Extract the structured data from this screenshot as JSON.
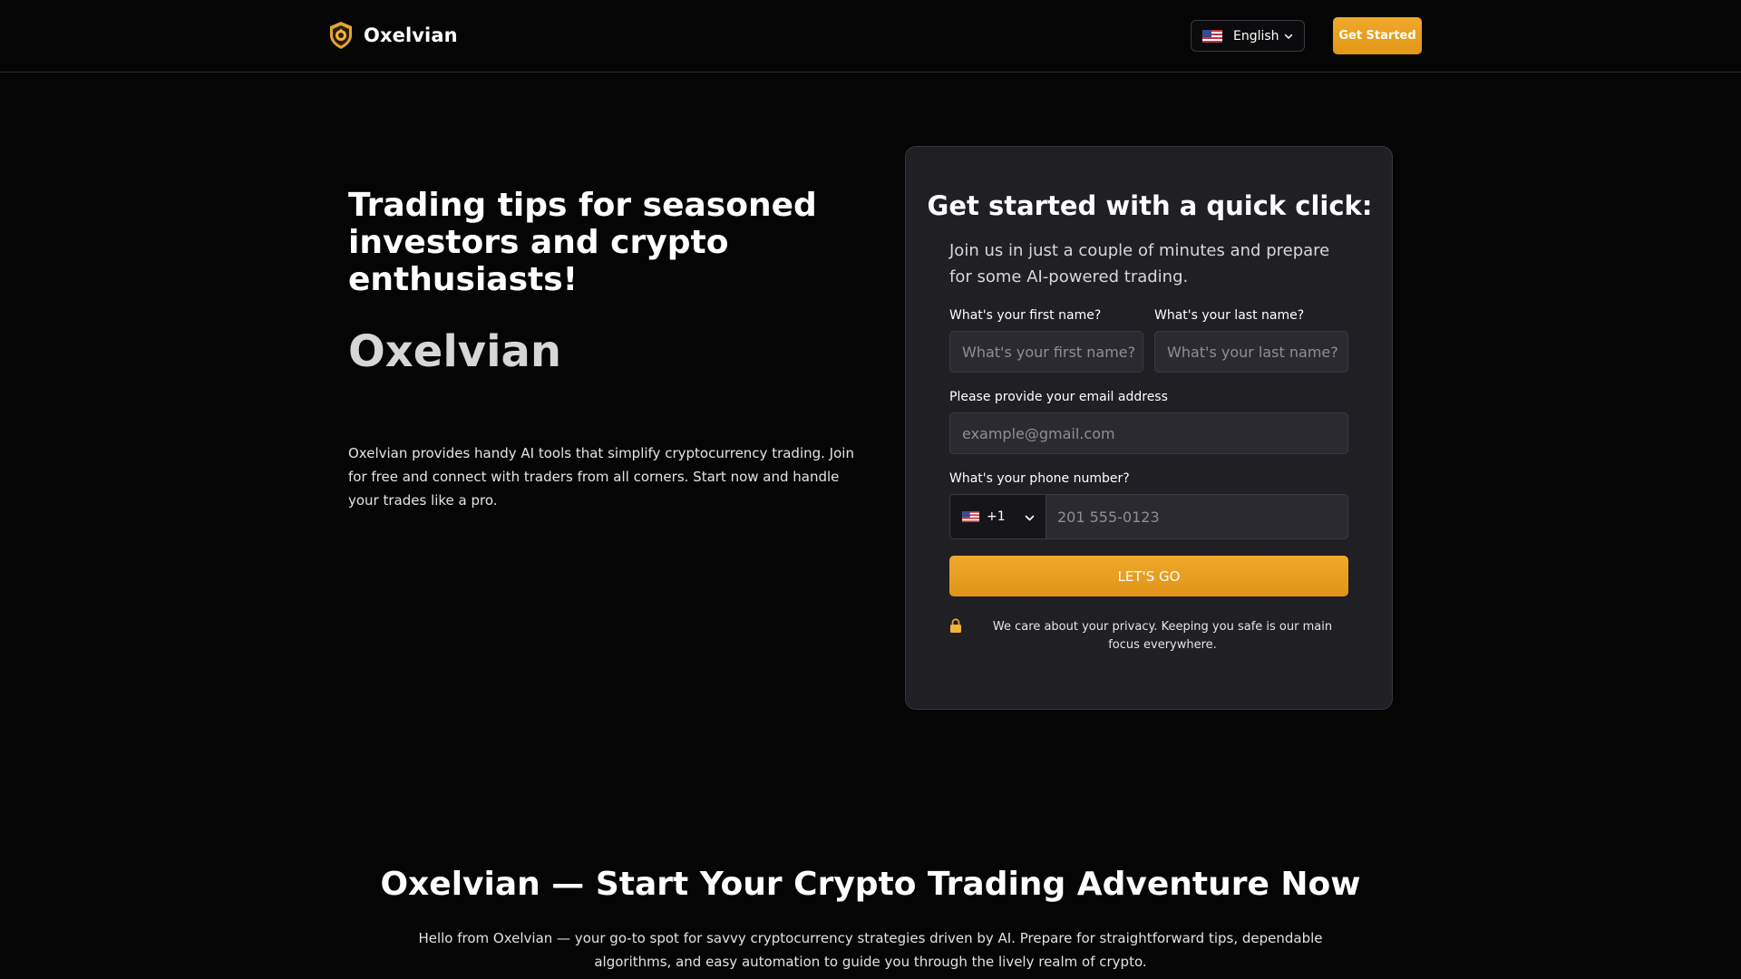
{
  "header": {
    "brand": "Oxelvian",
    "language": {
      "selected": "English",
      "flag": "us-flag-icon"
    },
    "cta_label": "Get Started"
  },
  "hero": {
    "title": "Trading tips for seasoned investors and crypto enthusiasts!",
    "brand": "Oxelvian",
    "description": "Oxelvian provides handy AI tools that simplify cryptocurrency trading. Join for free and connect with traders from all corners. Start now and handle your trades like a pro."
  },
  "form": {
    "title": "Get started with a quick click:",
    "subtitle": "Join us in just a couple of minutes and prepare for some AI-powered trading.",
    "first_name": {
      "label": "What's your first name?",
      "placeholder": "What's your first name?",
      "value": ""
    },
    "last_name": {
      "label": "What's your last name?",
      "placeholder": "What's your last name?",
      "value": ""
    },
    "email": {
      "label": "Please provide your email address",
      "placeholder": "example@gmail.com",
      "value": ""
    },
    "phone": {
      "label": "What's your phone number?",
      "country_code": "+1",
      "flag": "us-flag-icon",
      "placeholder": "201 555-0123",
      "value": ""
    },
    "submit_label": "LET'S GO",
    "privacy_text": "We care about your privacy. Keeping you safe is our main focus everywhere."
  },
  "section": {
    "title": "Oxelvian — Start Your Crypto Trading Adventure Now",
    "description": "Hello from Oxelvian — your go-to spot for savvy cryptocurrency strategies driven by AI. Prepare for straightforward tips, dependable algorithms, and easy automation to guide you through the lively realm of crypto."
  },
  "colors": {
    "background": "#050505",
    "card": "#1f1f24",
    "accent": "#eba226",
    "input": "#2a2a30"
  }
}
